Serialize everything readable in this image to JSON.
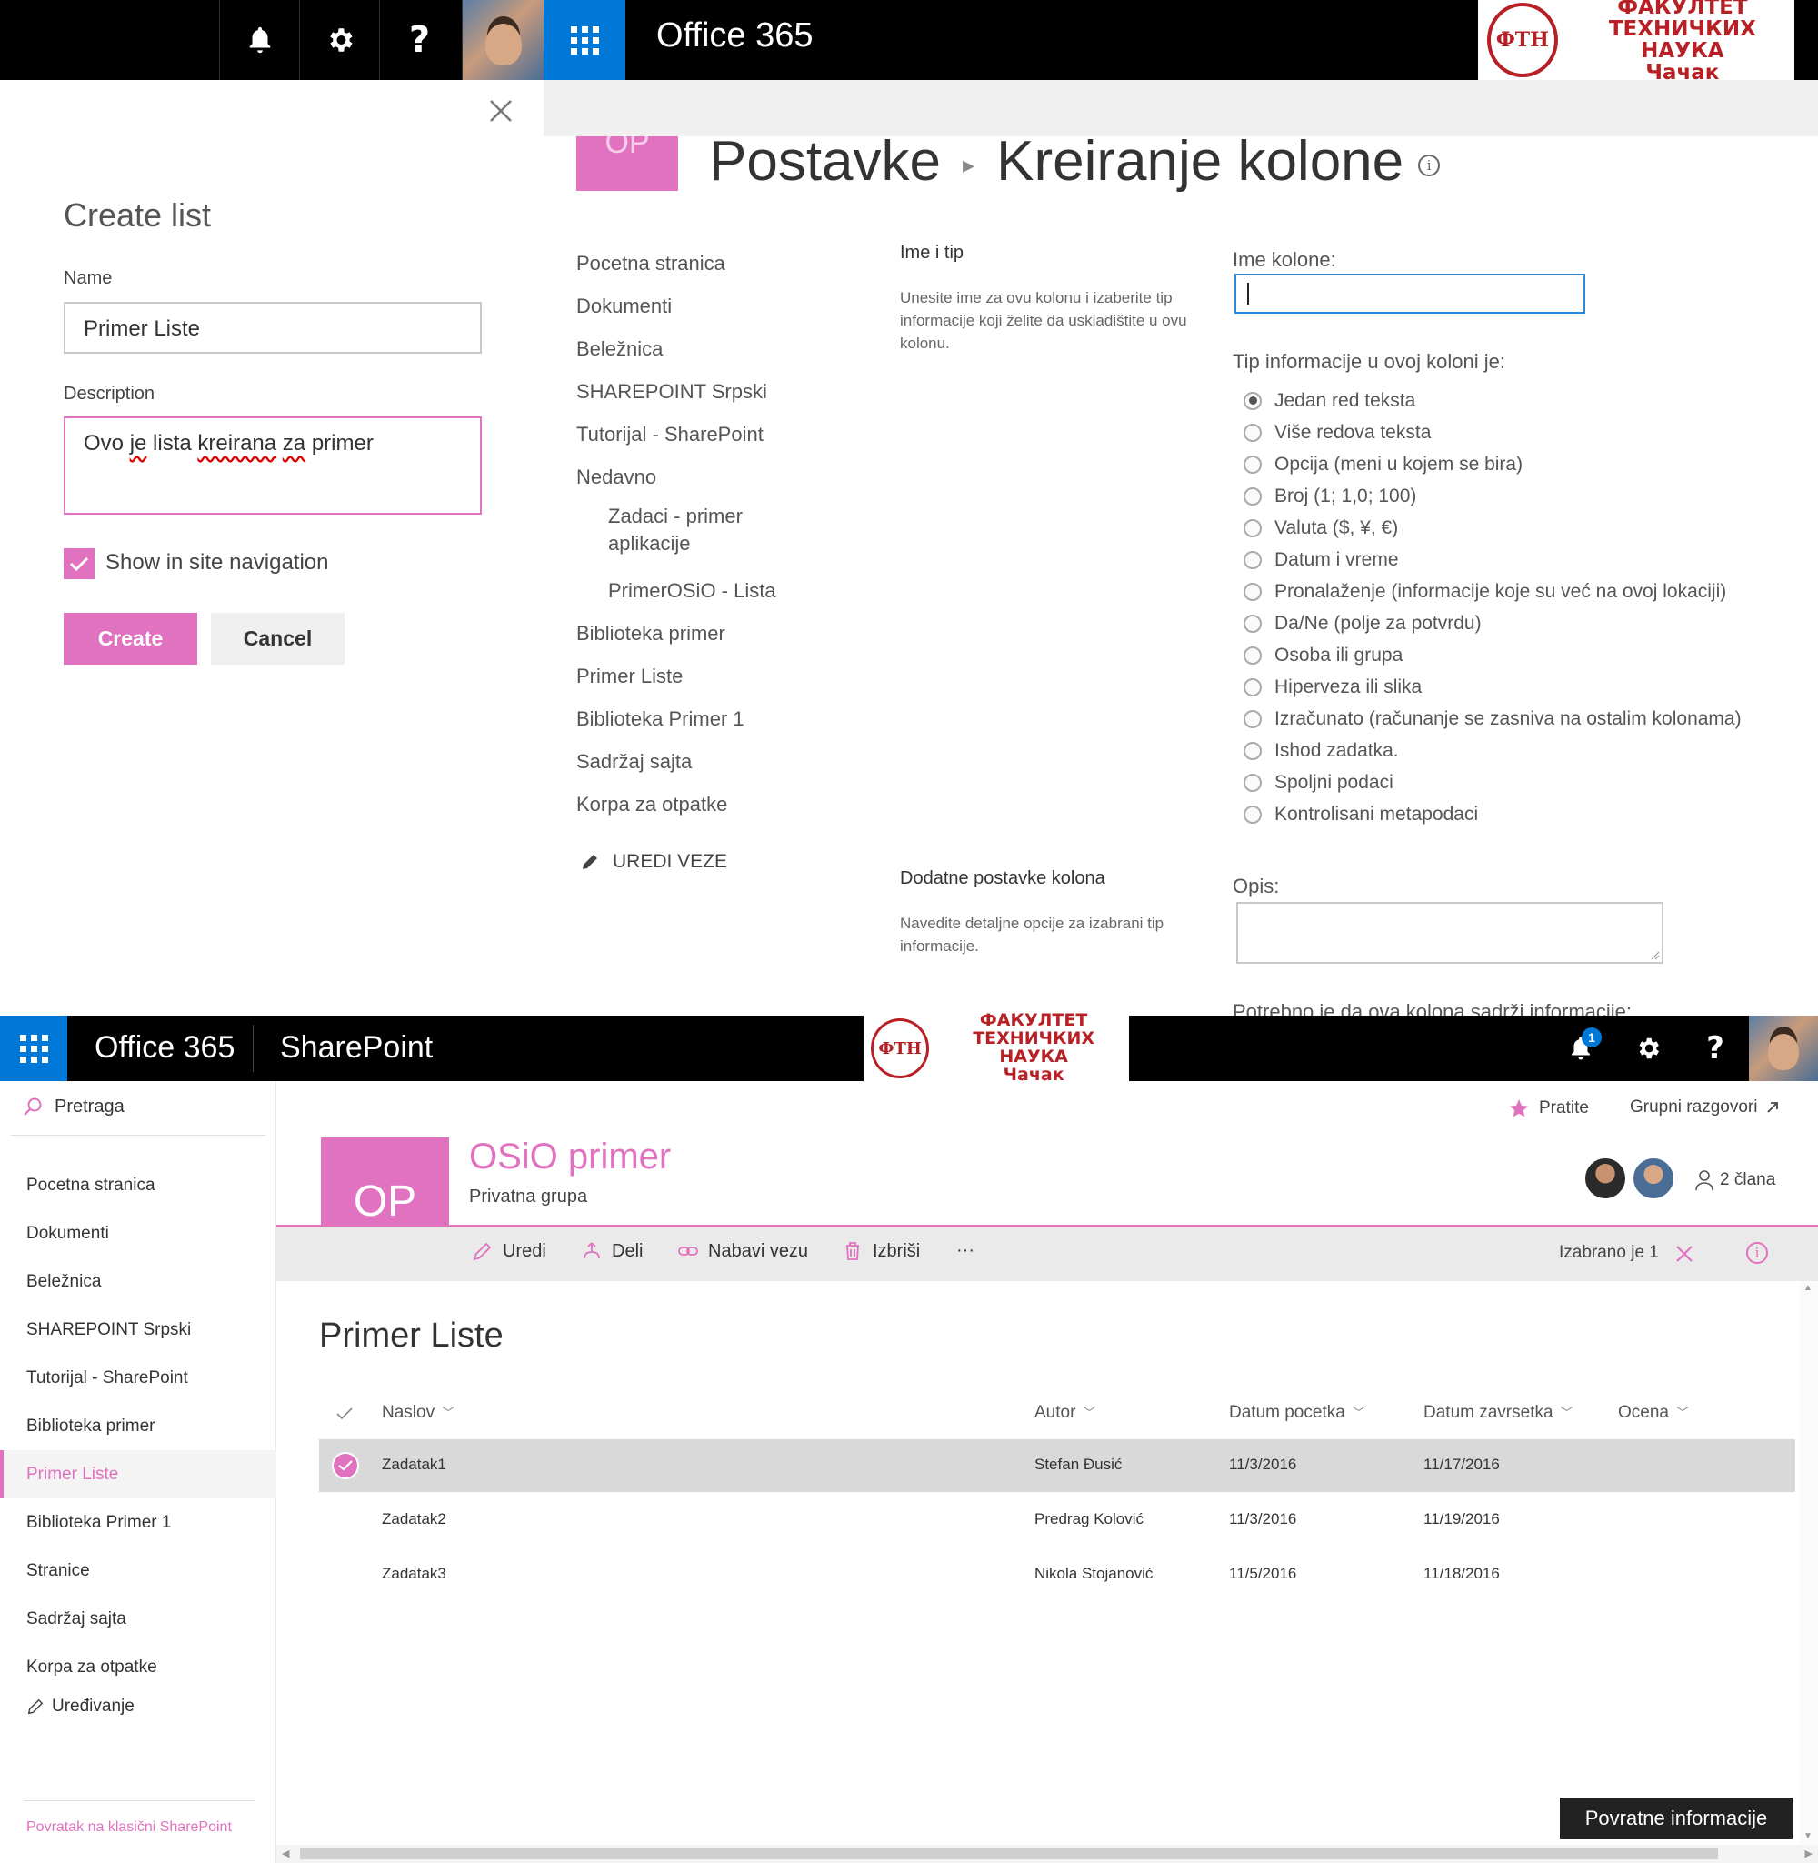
{
  "top": {
    "app_title": "Office 365",
    "logo": {
      "emblem": "ФТН",
      "line1": "ФАКУЛТЕТ",
      "line2": "ТЕХНИЧКИХ НАУКА",
      "line3": "Чачак"
    },
    "icons": [
      "bell-icon",
      "gear-icon",
      "help-icon",
      "avatar",
      "app-launcher-icon"
    ]
  },
  "create_list": {
    "title": "Create list",
    "name_label": "Name",
    "name_value": "Primer Liste",
    "description_label": "Description",
    "description_value_words": [
      "Ovo",
      "je",
      "lista",
      "kreirana",
      "za",
      "primer"
    ],
    "show_in_nav_label": "Show in site navigation",
    "show_in_nav_checked": true,
    "create_label": "Create",
    "cancel_label": "Cancel"
  },
  "settings": {
    "tile_text": "OP",
    "breadcrumb_parent": "Postavke",
    "breadcrumb_current": "Kreiranje kolone",
    "nav": [
      "Pocetna stranica",
      "Dokumenti",
      "Beležnica",
      "SHAREPOINT Srpski",
      "Tutorijal - SharePoint",
      "Nedavno"
    ],
    "nav_recent": [
      "Zadaci - primer aplikacije",
      "PrimerOSiO - Lista"
    ],
    "nav_after": [
      "Biblioteka primer",
      "Primer Liste",
      "Biblioteka Primer 1",
      "Sadržaj sajta",
      "Korpa za otpatke"
    ],
    "edit_links_label": "UREDI VEZE",
    "section1_title": "Ime i tip",
    "section1_desc": "Unesite ime za ovu kolonu i izaberite tip informacije koji želite da uskladištite u ovu kolonu.",
    "column_name_label": "Ime kolone:",
    "column_name_value": "",
    "type_label": "Tip informacije u ovoj koloni je:",
    "types": [
      "Jedan red teksta",
      "Više redova teksta",
      "Opcija (meni u kojem se bira)",
      "Broj (1; 1,0; 100)",
      "Valuta ($, ¥, €)",
      "Datum i vreme",
      "Pronalaženje (informacije koje su već na ovoj lokaciji)",
      "Da/Ne (polje za potvrdu)",
      "Osoba ili grupa",
      "Hiperveza ili slika",
      "Izračunato (računanje se zasniva na ostalim kolonama)",
      "Ishod zadatka.",
      "Spoljni podaci",
      "Kontrolisani metapodaci"
    ],
    "selected_type_index": 0,
    "section2_title": "Dodatne postavke kolona",
    "section2_desc": "Navedite detaljne opcije za izabrani tip informacije.",
    "description_label": "Opis:",
    "required_label": "Potrebno je da ova kolona sadrži informacije:"
  },
  "bottom": {
    "app_title": "Office 365",
    "product": "SharePoint",
    "notification_count": "1",
    "search_label": "Pretraga",
    "nav": [
      "Pocetna stranica",
      "Dokumenti",
      "Beležnica",
      "SHAREPOINT Srpski",
      "Tutorijal - SharePoint",
      "Biblioteka primer",
      "Primer Liste",
      "Biblioteka Primer 1",
      "Stranice",
      "Sadržaj sajta",
      "Korpa za otpatke"
    ],
    "active_nav_index": 6,
    "edit_label": "Uređivanje",
    "classic_link": "Povratak na klasični SharePoint",
    "follow_label": "Pratite",
    "conversations_label": "Grupni razgovori",
    "tile_text": "OP",
    "group_name": "OSiO primer",
    "group_privacy": "Privatna grupa",
    "members_label": "2 člana",
    "commands": {
      "edit": "Uredi",
      "share": "Deli",
      "get_link": "Nabavi vezu",
      "delete": "Izbriši",
      "more": "···"
    },
    "selected_label": "Izabrano je 1",
    "list_title": "Primer Liste",
    "columns": [
      "Naslov",
      "Autor",
      "Datum pocetka",
      "Datum zavrsetka",
      "Ocena"
    ],
    "rows": [
      {
        "title": "Zadatak1",
        "author": "Stefan Đusić",
        "start": "11/3/2016",
        "end": "11/17/2016",
        "rating": "",
        "selected": true
      },
      {
        "title": "Zadatak2",
        "author": "Predrag Kolović",
        "start": "11/3/2016",
        "end": "11/19/2016",
        "rating": "",
        "selected": false
      },
      {
        "title": "Zadatak3",
        "author": "Nikola Stojanović",
        "start": "11/5/2016",
        "end": "11/18/2016",
        "rating": "",
        "selected": false
      }
    ],
    "feedback_label": "Povratne informacije",
    "accent_color": "#e072bf",
    "brand_blue": "#0078d7"
  }
}
